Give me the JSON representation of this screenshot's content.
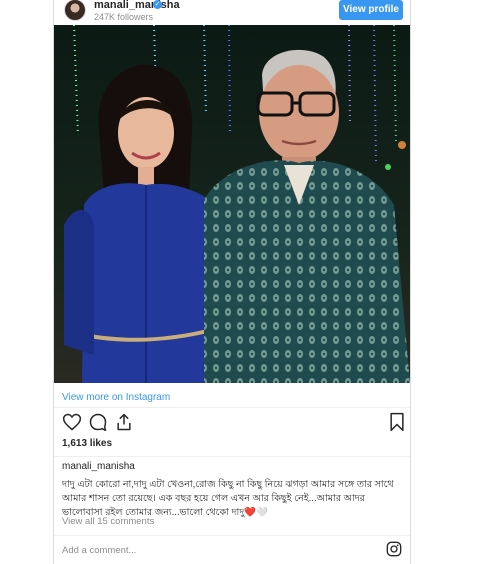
{
  "header": {
    "username": "manali_manisha",
    "followers": "247K followers",
    "view_profile_label": "View profile"
  },
  "post": {
    "view_more_label": "View more on Instagram",
    "likes": "1,613 likes",
    "caption_user": "manali_manisha",
    "caption_text": "দাদু এটা কোরো না,দাদু এটা খেওনা,রোজ কিছু না কিছু নিয়ে ঝগড়া আমার সঙ্গে তার সাথে আমার শাসন তো রয়েছে। এক বছর হয়ে গেল এখন আর কিছুই নেই...আমার আদর ভালোবাসা রইল তোমার জন্য...ভালো থেকো দাদু",
    "caption_emoji": "❤️🤍",
    "comments_link": "View all 15 comments",
    "add_comment_placeholder": "Add a comment..."
  },
  "icons": [
    "heart-icon",
    "comment-icon",
    "share-icon",
    "bookmark-icon",
    "instagram-icon",
    "verified-icon"
  ],
  "colors": {
    "accent": "#3897f0",
    "border": "#dbdbdb",
    "muted": "#8e8e8e",
    "heart": "#ed4956"
  }
}
